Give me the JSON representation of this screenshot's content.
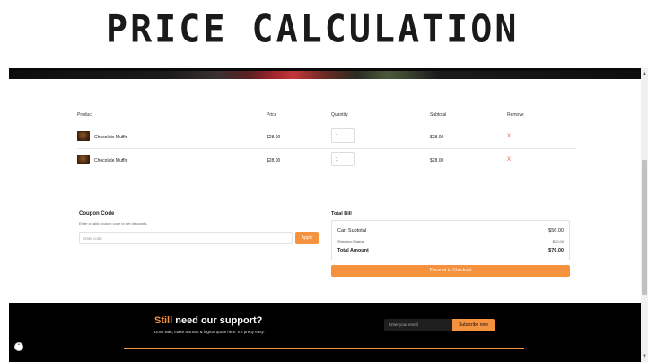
{
  "banner": {
    "title": "PRICE CALCULATION"
  },
  "cart": {
    "headers": {
      "product": "Product",
      "price": "Price",
      "quantity": "Quantity",
      "subtotal": "Subtotal",
      "remove": "Remove"
    },
    "items": [
      {
        "name": "Chocolate Muffin",
        "price": "$28.00",
        "quantity": "1",
        "subtotal": "$28.00",
        "remove": "X"
      },
      {
        "name": "Chocolate Muffin",
        "price": "$28.00",
        "quantity": "1",
        "subtotal": "$28.00",
        "remove": "X"
      }
    ]
  },
  "coupon": {
    "title": "Coupon Code",
    "description": "Enter a valid coupon code to get discounts.",
    "placeholder": "Enter code",
    "apply_label": "Apply"
  },
  "bill": {
    "title": "Total Bill",
    "cart_subtotal_label": "Cart Subtotal",
    "cart_subtotal_value": "$56.00",
    "shipping_label": "Shipping Charge",
    "shipping_value": "$20.00",
    "total_label": "Total Amount",
    "total_value": "$76.00",
    "checkout_label": "Proceed to Checkout"
  },
  "footer": {
    "support_accent": "Still",
    "support_rest": " need our support?",
    "support_desc": "Don't wait, make a smart & logical quote here. It's pretty easy.",
    "email_placeholder": "Enter your email",
    "subscribe_label": "Subscribe now"
  },
  "scrollbar": {
    "up_glyph": "▲",
    "down_glyph": "▼"
  },
  "float_button": {
    "glyph": "⌃"
  },
  "colors": {
    "accent": "#f5923e",
    "remove": "#e8584a",
    "footer_bg": "#000000"
  }
}
